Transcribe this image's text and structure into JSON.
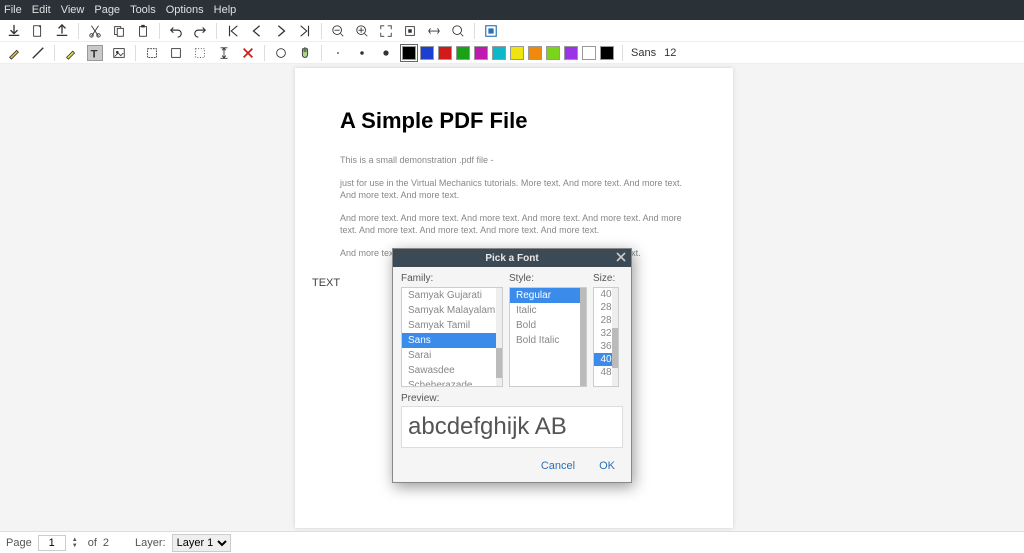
{
  "menu": {
    "file": "File",
    "edit": "Edit",
    "view": "View",
    "page": "Page",
    "tools": "Tools",
    "options": "Options",
    "help": "Help"
  },
  "toolbar2": {
    "font_name": "Sans",
    "font_size": "12"
  },
  "swatches": [
    "#000000",
    "#1b3fd1",
    "#d11b1b",
    "#17a217",
    "#bf19b0",
    "#0fb8c9",
    "#f0e40f",
    "#f08a0f",
    "#7bd41b",
    "#9b33e6",
    "#ffffff",
    "#000000"
  ],
  "doc": {
    "title": "A Simple PDF File",
    "p1": "This is a small demonstration .pdf file -",
    "p2": "just for use in the Virtual Mechanics tutorials. More text. And more text. And more text. And more text. And more text.",
    "p3": "And more text. And more text. And more text. And more text. And more text. And more text. And more text. And more text. And more text. And more text.",
    "p4": "And more text. And more text. And more text. And more text. And more text.",
    "text_obj": "TEXT"
  },
  "status": {
    "page_label": "Page",
    "page_current": "1",
    "of_label": "of",
    "page_total": "2",
    "layer_label": "Layer:",
    "layer_value": "Layer 1"
  },
  "dialog": {
    "title": "Pick a Font",
    "family_label": "Family:",
    "style_label": "Style:",
    "size_label": "Size:",
    "families": [
      "Samyak Gujarati",
      "Samyak Malayalam",
      "Samyak Tamil",
      "Sans",
      "Sarai",
      "Sawasdee",
      "Scheherazade"
    ],
    "family_selected_index": 3,
    "styles": [
      "Regular",
      "Italic",
      "Bold",
      "Bold Italic"
    ],
    "style_selected_index": 0,
    "sizes": [
      "40",
      "28",
      "28",
      "32",
      "36",
      "40",
      "48"
    ],
    "size_selected_index": 5,
    "preview_label": "Preview:",
    "preview_text": "abcdefghijk AB",
    "cancel": "Cancel",
    "ok": "OK"
  }
}
